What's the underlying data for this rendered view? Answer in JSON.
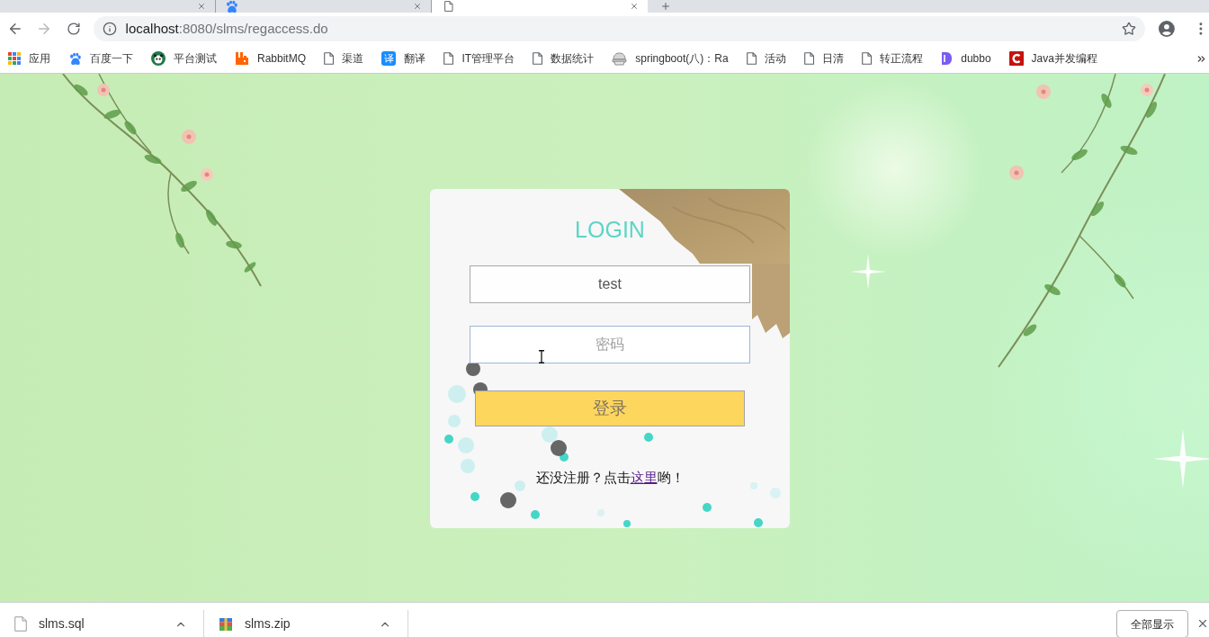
{
  "tabs": [
    {
      "selected": false
    },
    {
      "selected": false,
      "kind": "paw"
    },
    {
      "selected": true,
      "kind": "page"
    }
  ],
  "address_bar": {
    "host": "localhost",
    "path": ":8080/slms/regaccess.do"
  },
  "bookmarks": [
    {
      "label": "应用",
      "kind": "apps"
    },
    {
      "label": "百度一下",
      "kind": "paw"
    },
    {
      "label": "平台测试",
      "kind": "panda"
    },
    {
      "label": "RabbitMQ",
      "kind": "rabbit"
    },
    {
      "label": "渠道",
      "kind": "page"
    },
    {
      "label": "翻译",
      "kind": "translate",
      "icon_text": "译"
    },
    {
      "label": "IT管理平台",
      "kind": "page"
    },
    {
      "label": "数据统计",
      "kind": "page"
    },
    {
      "label": "springboot(八)：Ra",
      "kind": "cap"
    },
    {
      "label": "活动",
      "kind": "page"
    },
    {
      "label": "日清",
      "kind": "page"
    },
    {
      "label": "转正流程",
      "kind": "page"
    },
    {
      "label": "dubbo",
      "kind": "dubbo"
    },
    {
      "label": "Java并发编程",
      "kind": "java"
    }
  ],
  "login": {
    "title": "LOGIN",
    "username": {
      "value": "test"
    },
    "password": {
      "placeholder": "密码",
      "focused": true
    },
    "submit": "登录",
    "register_prompt": {
      "text_before": "还没注册？点击",
      "link": "这里",
      "text_after": "哟！"
    }
  },
  "downloads": {
    "items": [
      {
        "name": "slms.sql",
        "kind": "file"
      },
      {
        "name": "slms.zip",
        "kind": "archive"
      }
    ],
    "show_all": "全部显示"
  }
}
